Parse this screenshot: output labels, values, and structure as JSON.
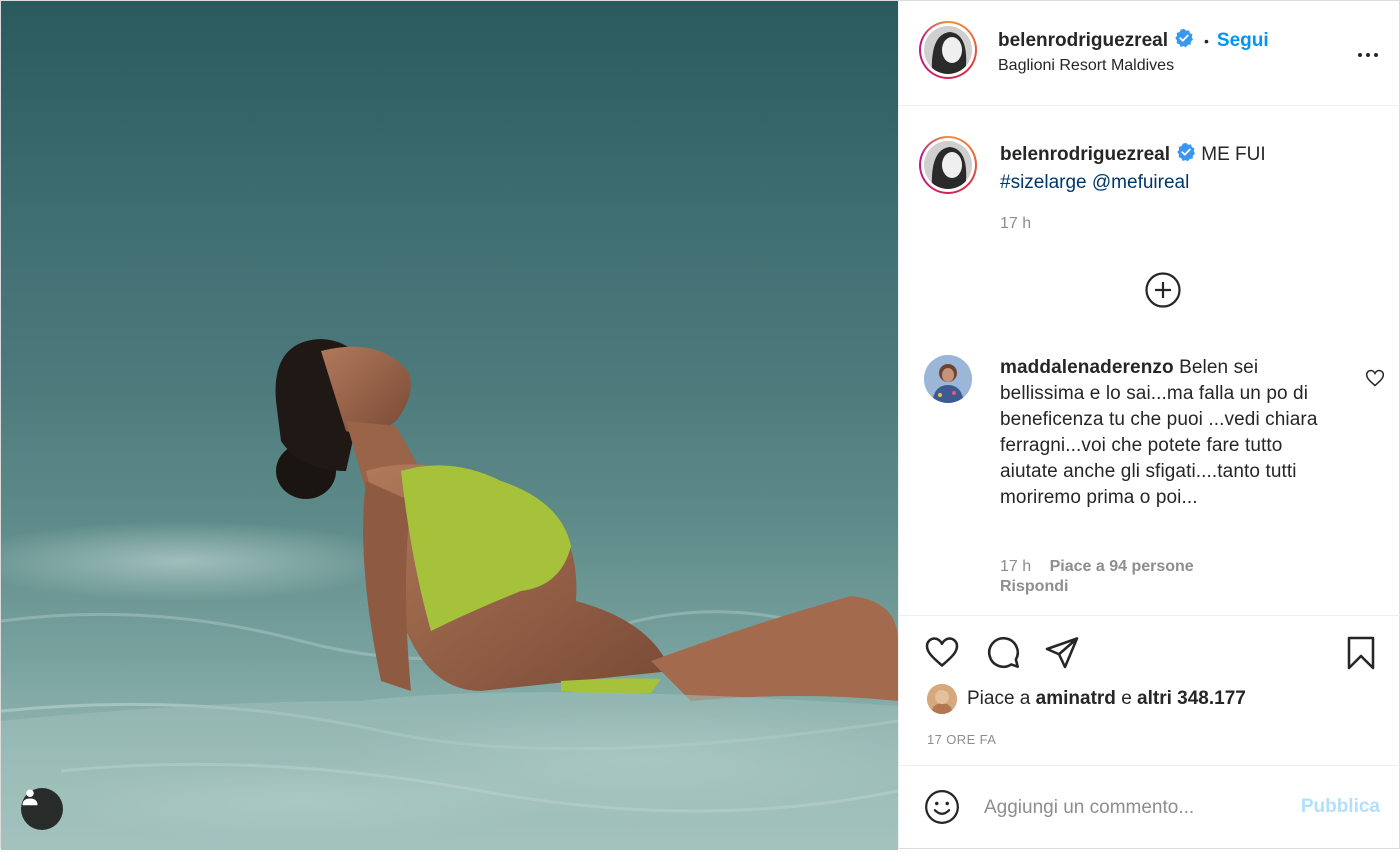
{
  "author": {
    "username": "belenrodriguezreal",
    "verified": true,
    "follow_label": "Segui",
    "separator": "•",
    "location": "Baglioni Resort Maldives"
  },
  "caption": {
    "username": "belenrodriguezreal",
    "text": "ME FUI",
    "hashtag": "#sizelarge",
    "mention": "@mefuireal",
    "time": "17 h"
  },
  "comment": {
    "username": "maddalenaderenzo",
    "text": "Belen sei bellissima e lo sai...ma falla un po di beneficenza tu che puoi ...vedi chiara ferragni...voi che potete fare tutto aiutate anche gli sfigati....tanto tutti moriremo prima o poi...",
    "time": "17 h",
    "likes": "Piace a 94 persone",
    "reply": "Rispondi"
  },
  "likes": {
    "prefix": "Piace a",
    "user": "aminatrd",
    "middle": "e",
    "others": "altri 348.177"
  },
  "post_time": "17 ORE FA",
  "add_comment": {
    "placeholder": "Aggiungi un commento...",
    "publish_label": "Pubblica"
  },
  "colors": {
    "link": "#0095f6",
    "hashtag": "#00376b",
    "muted": "#8e8e8e",
    "publish_disabled": "#b2dffc"
  },
  "icons": {
    "tag": "user-tag-icon",
    "verified": "verified-badge-icon",
    "more": "more-options-icon",
    "load_more": "plus-circle-icon",
    "comment_like": "heart-icon",
    "like": "heart-icon",
    "comment": "comment-icon",
    "share": "share-icon",
    "save": "bookmark-icon",
    "emoji": "emoji-icon"
  }
}
